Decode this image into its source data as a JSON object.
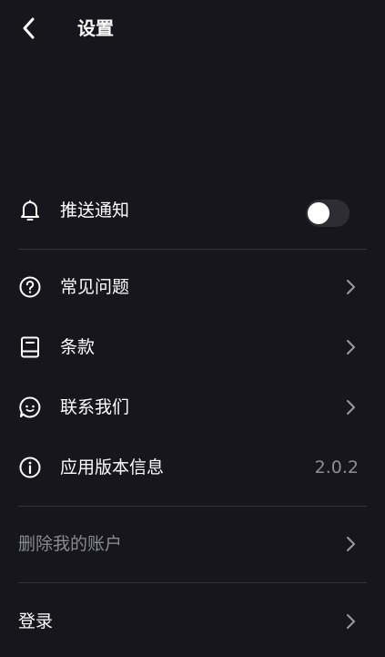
{
  "header": {
    "title": "设置"
  },
  "settings": {
    "push": {
      "label": "推送通知",
      "icon": "bell-icon",
      "enabled": false
    },
    "faq": {
      "label": "常见问题",
      "icon": "question-circle-icon"
    },
    "terms": {
      "label": "条款",
      "icon": "book-icon"
    },
    "contact": {
      "label": "联系我们",
      "icon": "chat-bubble-icon"
    },
    "version": {
      "label": "应用版本信息",
      "icon": "info-circle-icon",
      "value": "2.0.2"
    }
  },
  "account": {
    "delete_label": "删除我的账户",
    "login_label": "登录"
  },
  "colors": {
    "background": "#17161c",
    "text": "#ffffff",
    "muted_text": "#8a8a93",
    "divider": "#34333a",
    "toggle_off": "#2e2d33"
  }
}
